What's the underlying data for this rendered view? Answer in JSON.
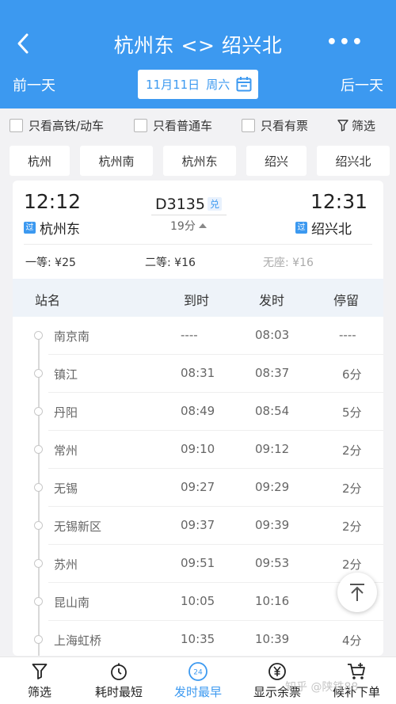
{
  "header": {
    "title": "杭州东 <> 绍兴北",
    "more_label": "•••",
    "prev_day": "前一天",
    "next_day": "后一天",
    "date": "11月11日",
    "weekday": "周六"
  },
  "filters": {
    "high_speed_only": "只看高铁/动车",
    "regular_only": "只看普通车",
    "available_only": "只看有票",
    "screen": "筛选"
  },
  "station_tabs": [
    "杭州",
    "杭州南",
    "杭州东",
    "绍兴",
    "绍兴北"
  ],
  "train": {
    "dep_time": "12:12",
    "arr_time": "12:31",
    "number": "D3135",
    "badge": "兑",
    "duration": "19分",
    "dep_station": "杭州东",
    "arr_station": "绍兴北",
    "pass_tag": "过",
    "prices": {
      "first": "一等: ¥25",
      "second": "二等: ¥16",
      "no_seat": "无座: ¥16"
    }
  },
  "stop_table": {
    "headers": [
      "站名",
      "到时",
      "发时",
      "停留"
    ],
    "rows": [
      {
        "name": "南京南",
        "arr": "----",
        "dep": "08:03",
        "stop": "----"
      },
      {
        "name": "镇江",
        "arr": "08:31",
        "dep": "08:37",
        "stop": "6分"
      },
      {
        "name": "丹阳",
        "arr": "08:49",
        "dep": "08:54",
        "stop": "5分"
      },
      {
        "name": "常州",
        "arr": "09:10",
        "dep": "09:12",
        "stop": "2分"
      },
      {
        "name": "无锡",
        "arr": "09:27",
        "dep": "09:29",
        "stop": "2分"
      },
      {
        "name": "无锡新区",
        "arr": "09:37",
        "dep": "09:39",
        "stop": "2分"
      },
      {
        "name": "苏州",
        "arr": "09:51",
        "dep": "09:53",
        "stop": "2分"
      },
      {
        "name": "昆山南",
        "arr": "10:05",
        "dep": "10:16",
        "stop": ""
      },
      {
        "name": "上海虹桥",
        "arr": "10:35",
        "dep": "10:39",
        "stop": "4分"
      }
    ]
  },
  "bottom_bar": {
    "items": [
      "筛选",
      "耗时最短",
      "发时最早",
      "显示余票",
      "候补下单"
    ],
    "active_index": 2,
    "clock_badge": "24"
  },
  "watermark": "知乎 @陕铁88",
  "colors": {
    "brand_blue": "#3c99f0",
    "background": "#f2f2f4"
  }
}
